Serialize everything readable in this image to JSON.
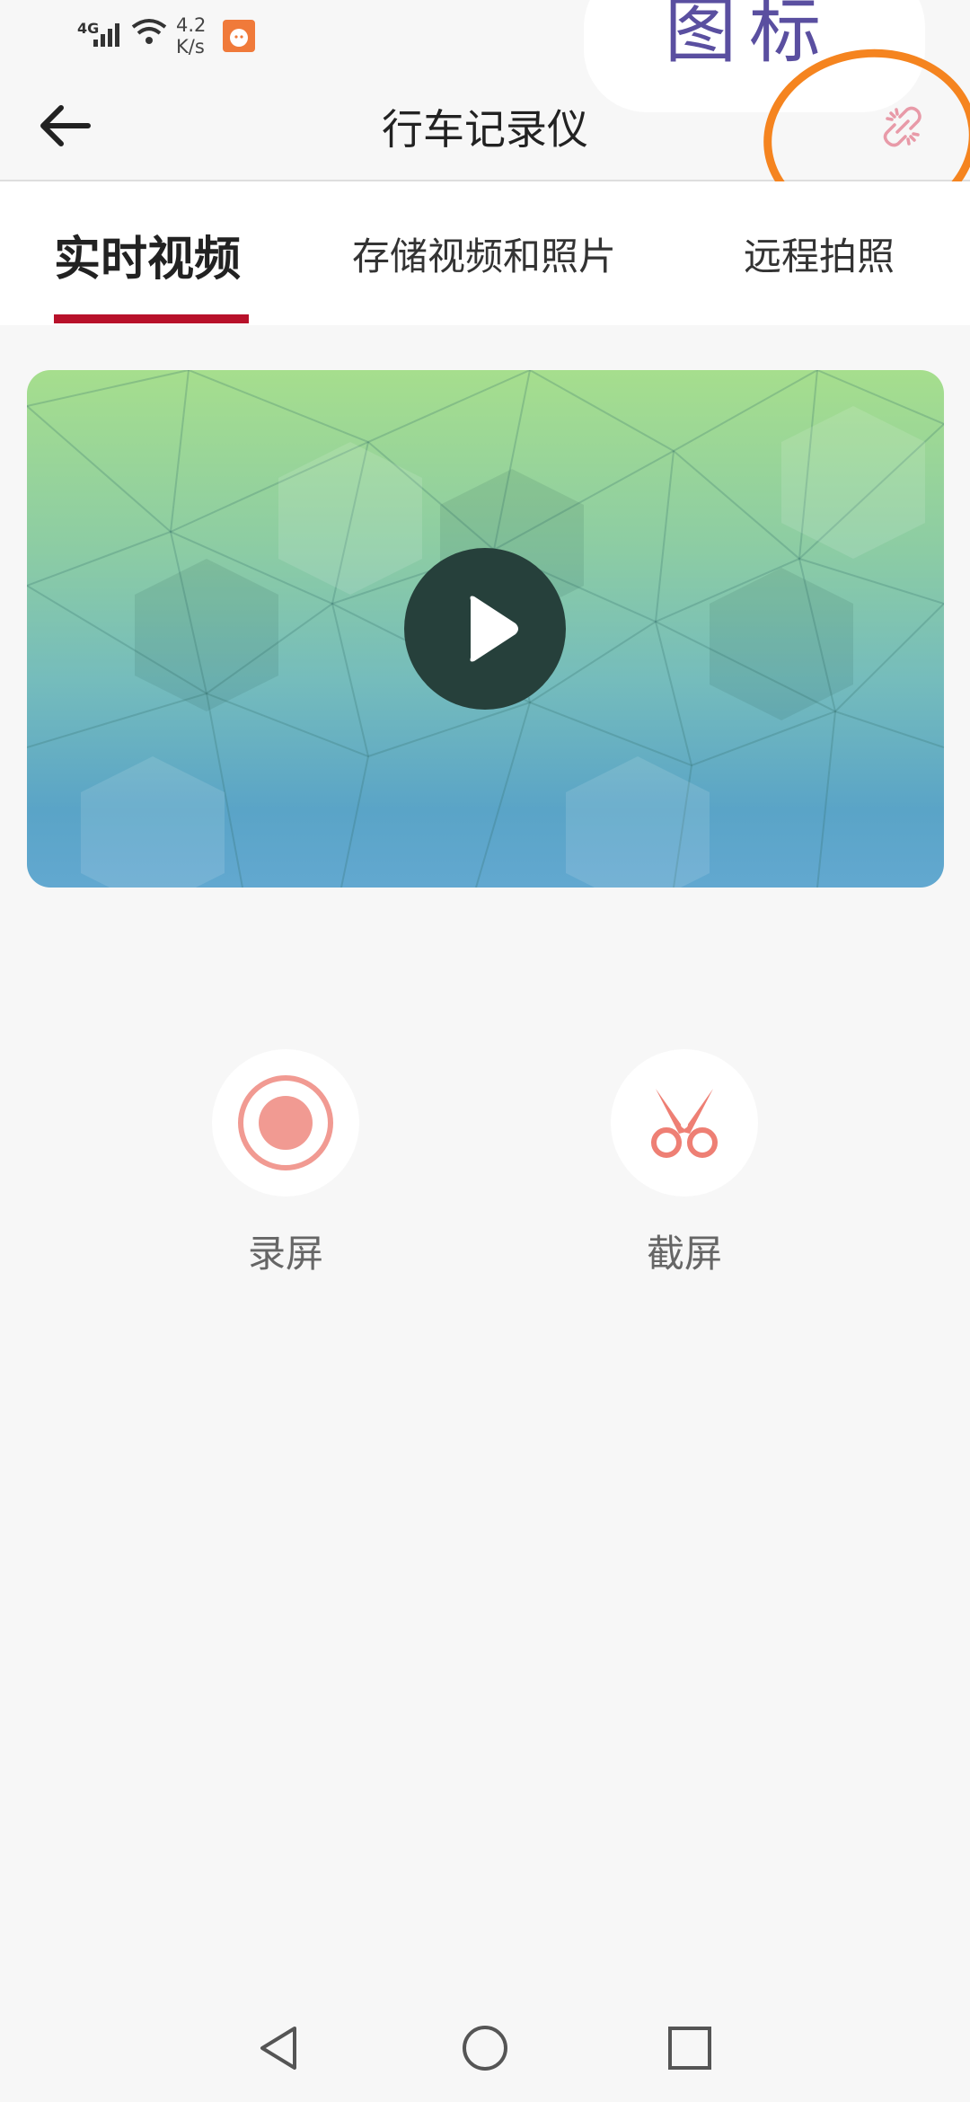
{
  "status_bar": {
    "network": "4G",
    "speed_value": "4.2",
    "speed_unit": "K/s"
  },
  "annotation": {
    "text": "图标"
  },
  "header": {
    "title": "行车记录仪"
  },
  "tabs": [
    {
      "label": "实时视频",
      "active": true
    },
    {
      "label": "存储视频和照片",
      "active": false
    },
    {
      "label": "远程拍照",
      "active": false
    }
  ],
  "actions": {
    "record_label": "录屏",
    "screenshot_label": "截屏"
  },
  "colors": {
    "accent": "#b8112a",
    "icon_red": "#f19a92",
    "annotation_orange": "#f5841f",
    "annotation_text": "#5a4fa0"
  },
  "icons": [
    "back-arrow-icon",
    "unlink-icon",
    "play-icon",
    "record-icon",
    "scissors-icon",
    "nav-back-icon",
    "nav-home-icon",
    "nav-recents-icon"
  ]
}
